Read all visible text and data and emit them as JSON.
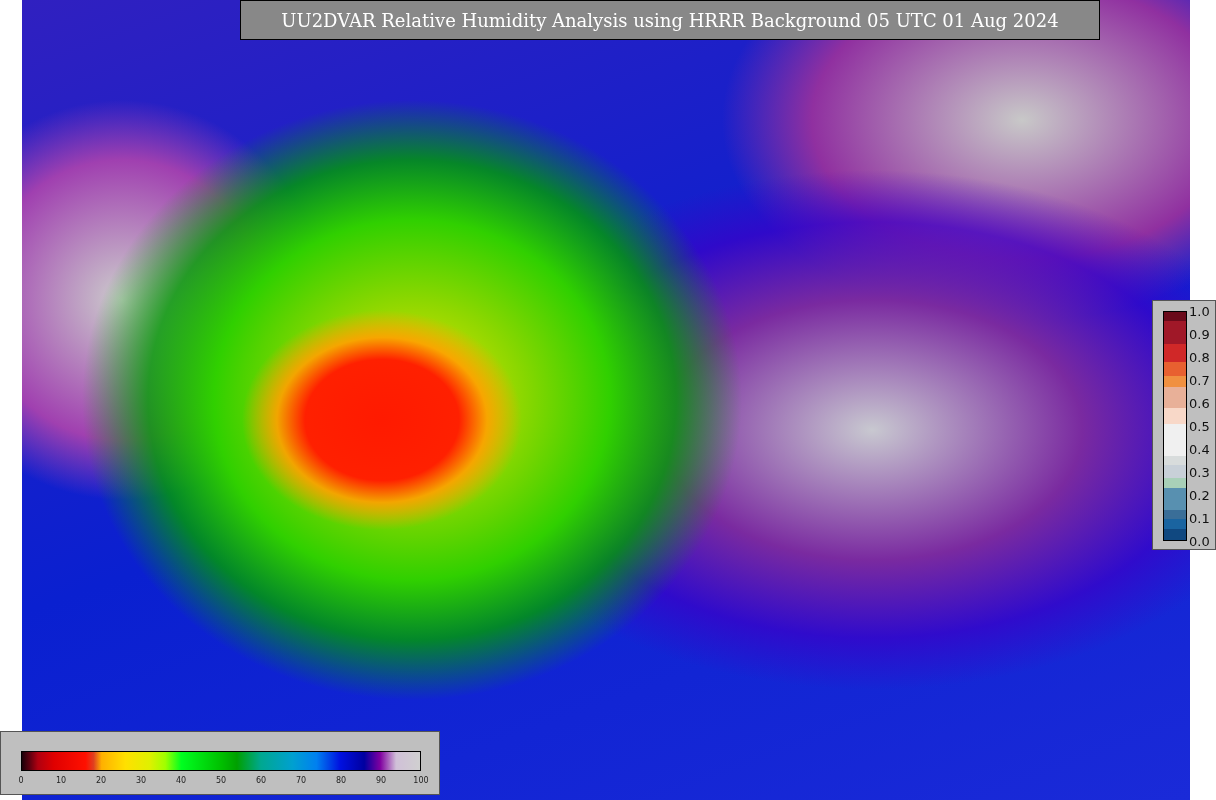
{
  "title": "UU2DVAR Relative Humidity Analysis using HRRR Background 05 UTC 01 Aug 2024",
  "humidity_colorbar": {
    "ticks": [
      "0",
      "10",
      "20",
      "30",
      "40",
      "50",
      "60",
      "70",
      "80",
      "90",
      "100"
    ]
  },
  "station_colorbar": {
    "ticks": [
      "1.0",
      "0.9",
      "0.8",
      "0.7",
      "0.6",
      "0.5",
      "0.4",
      "0.3",
      "0.2",
      "0.1",
      "0.0"
    ]
  }
}
